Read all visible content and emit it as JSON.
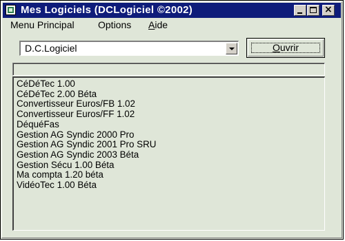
{
  "window": {
    "title": "Mes Logiciels (DCLogiciel ©2002)"
  },
  "titlebar": {
    "icon": "app-icon",
    "minimize_icon": "minimize-icon",
    "maximize_icon": "maximize-icon",
    "close_icon": "close-icon",
    "close_glyph": "×"
  },
  "menu": {
    "main": "Menu Principal",
    "options": "Options",
    "aide_first": "A",
    "aide_rest": "ide"
  },
  "combo": {
    "selected": "D.C.Logiciel",
    "arrow_icon": "chevron-down-icon"
  },
  "open_button": {
    "label_first": "O",
    "label_rest": "uvrir"
  },
  "list": {
    "items": [
      "CéDéTec 1.00",
      "CéDéTec 2.00 Béta",
      "Convertisseur Euros/FB 1.02",
      "Convertisseur Euros/FF 1.02",
      "DéquéFas",
      "Gestion AG Syndic 2000 Pro",
      "Gestion AG Syndic 2001 Pro SRU",
      "Gestion AG Syndic 2003 Béta",
      "Gestion Sécu 1.00 Béta",
      "Ma compta 1.20 béta",
      "VidéoTec 1.00 Béta"
    ]
  },
  "colors": {
    "titlebar": "#0e1c7a",
    "window_bg": "#dfe6d8"
  }
}
